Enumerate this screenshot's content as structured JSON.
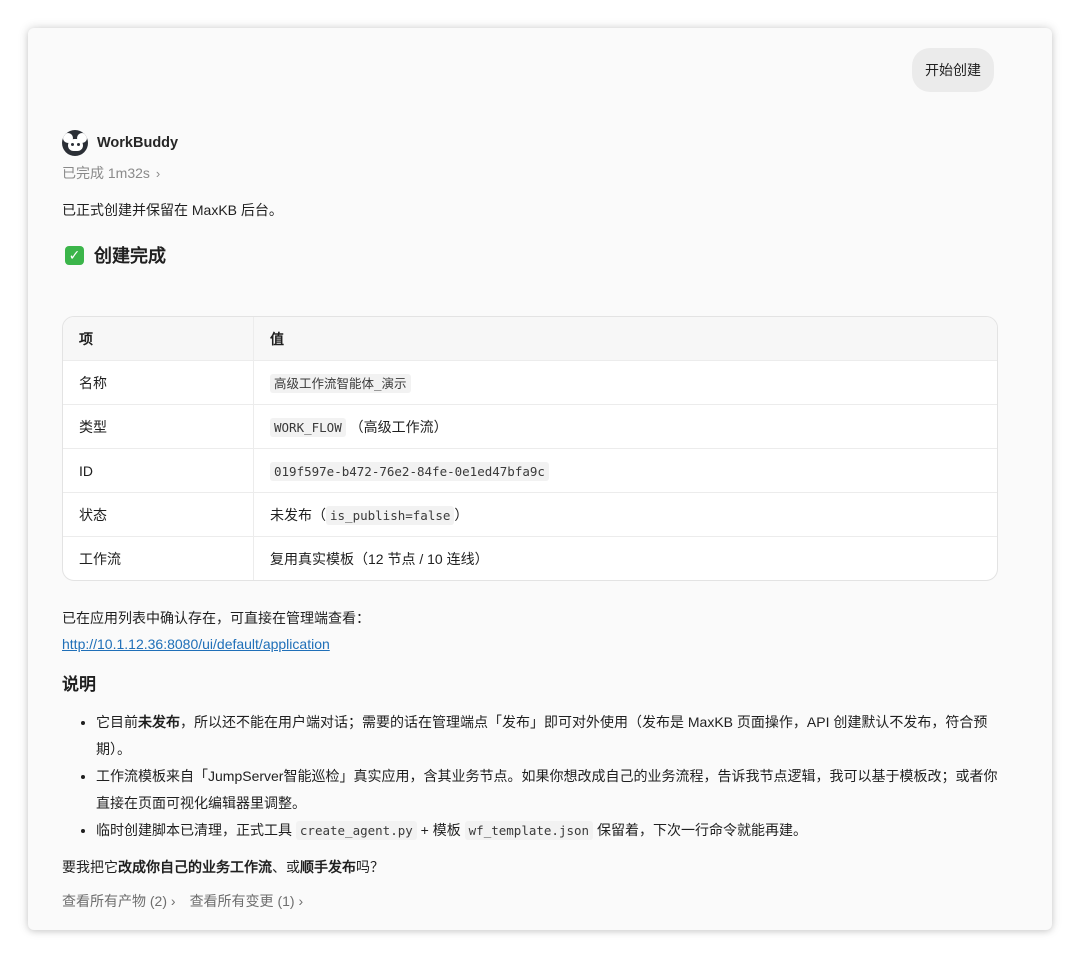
{
  "user_message": "开始创建",
  "agent": {
    "name": "WorkBuddy",
    "status": "已完成 1m32s",
    "status_chevron": "›"
  },
  "intro": "已正式创建并保留在 MaxKB 后台。",
  "section_title": "创建完成",
  "table": {
    "headers": [
      "项",
      "值"
    ],
    "rows": [
      {
        "key": "名称",
        "code": "高级工作流智能体_演示",
        "text": ""
      },
      {
        "key": "类型",
        "code": "WORK_FLOW",
        "text": "（高级工作流）"
      },
      {
        "key": "ID",
        "code": "019f597e-b472-76e2-84fe-0e1ed47bfa9c",
        "text": ""
      },
      {
        "key": "状态",
        "pre": "未发布（",
        "code": "is_publish=false",
        "text": "）"
      },
      {
        "key": "工作流",
        "code": "",
        "text": "复用真实模板（12 节点 / 10 连线）"
      }
    ]
  },
  "confirm_text": "已在应用列表中确认存在，可直接在管理端查看：",
  "admin_link": "http://10.1.12.36:8080/ui/default/application",
  "notes_title": "说明",
  "notes": {
    "n1_pre": "它目前",
    "n1_bold": "未发布",
    "n1_post": "，所以还不能在用户端对话；需要的话在管理端点「发布」即可对外使用（发布是 MaxKB 页面操作，API 创建默认不发布，符合预期）。",
    "n2": "工作流模板来自「JumpServer智能巡检」真实应用，含其业务节点。如果你想改成自己的业务流程，告诉我节点逻辑，我可以基于模板改；或者你直接在页面可视化编辑器里调整。",
    "n3_pre": "临时创建脚本已清理，正式工具",
    "n3_code1": "create_agent.py",
    "n3_mid": "+ 模板",
    "n3_code2": "wf_template.json",
    "n3_post": "保留着，下次一行命令就能再建。"
  },
  "question": {
    "pre": "要我把它",
    "bold1": "改成你自己的业务工作流",
    "mid": "、或",
    "bold2": "顺手发布",
    "post": "吗？"
  },
  "footer": {
    "artifacts": "查看所有产物 (2) ›",
    "changes": "查看所有变更 (1) ›"
  }
}
